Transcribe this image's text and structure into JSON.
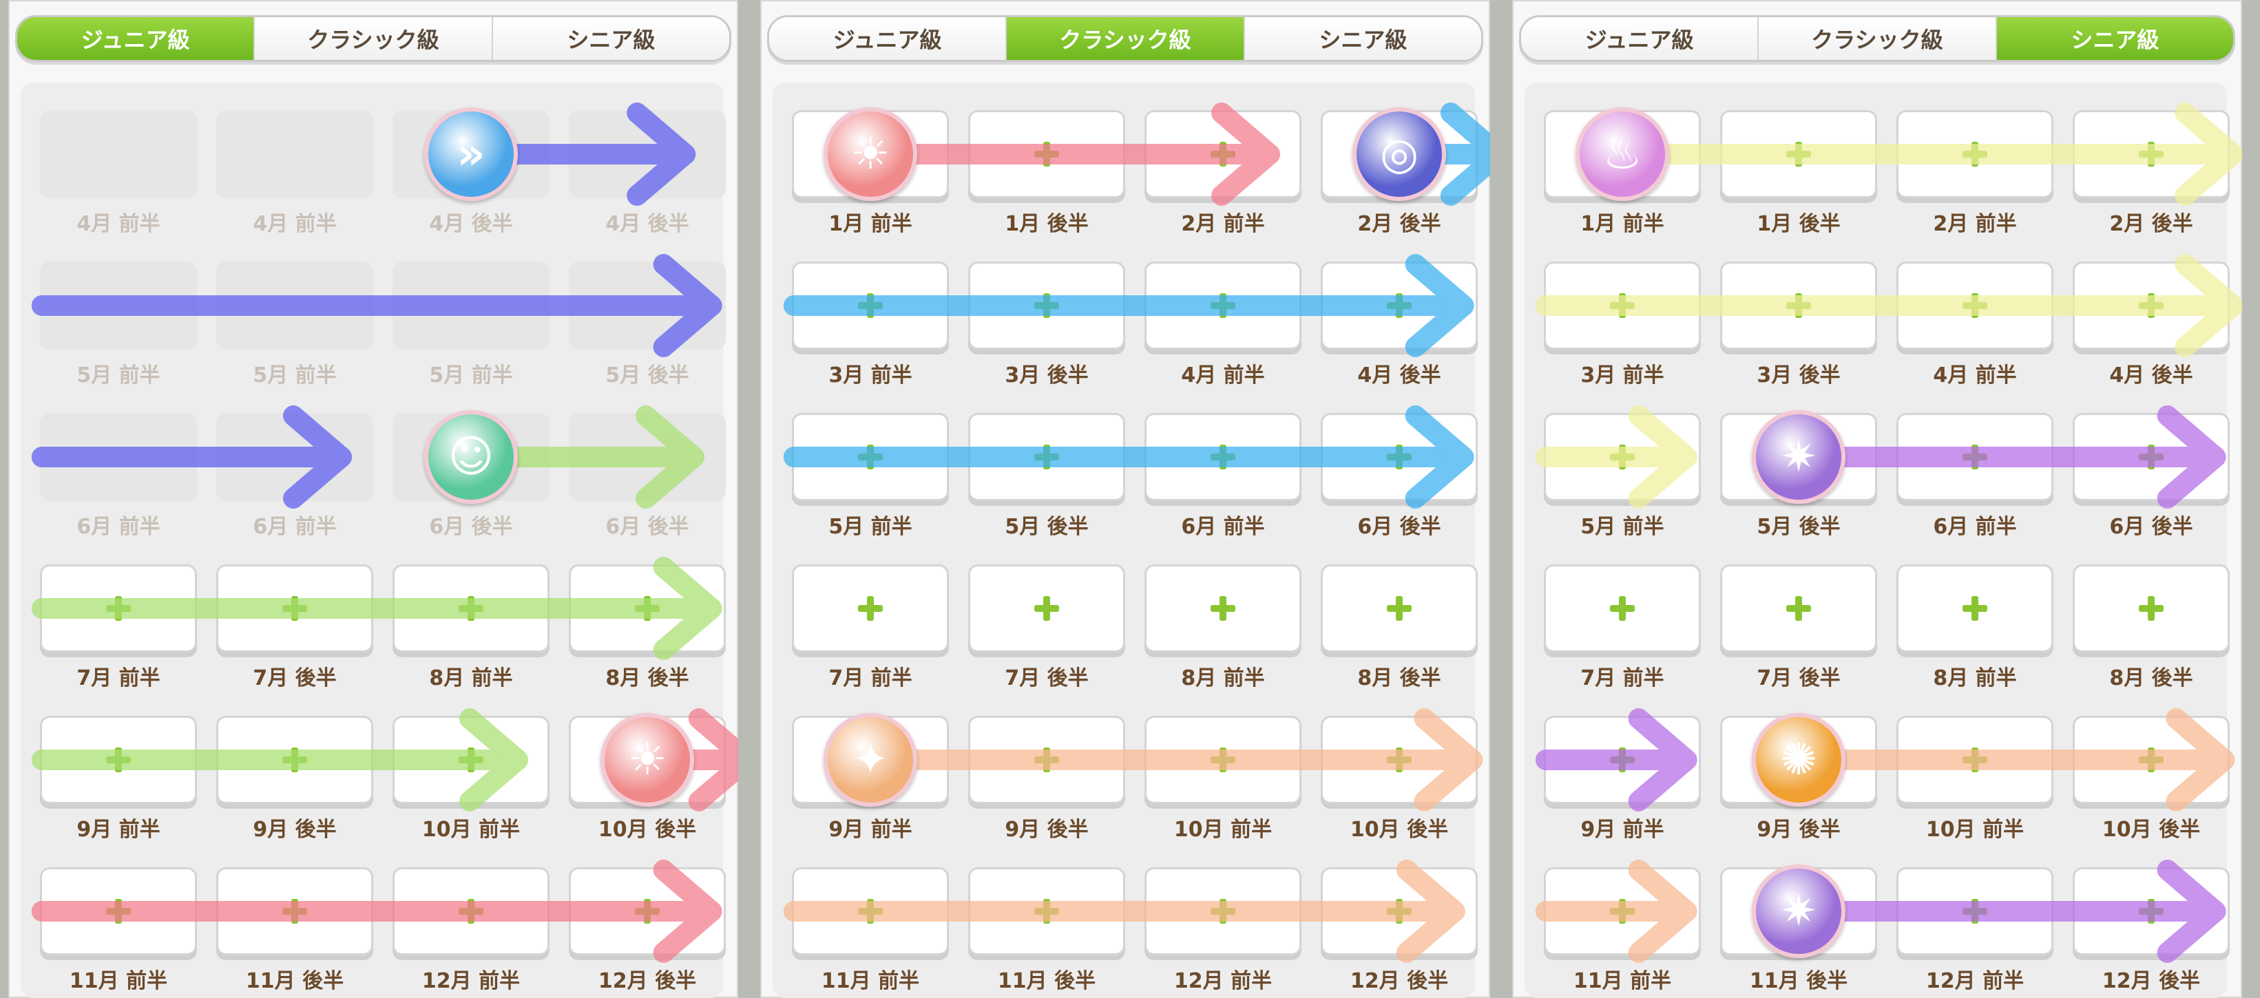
{
  "panels": [
    {
      "tabs": [
        {
          "label": "ジュニア級",
          "active": true
        },
        {
          "label": "クラシック級",
          "active": false
        },
        {
          "label": "シニア級",
          "active": false
        }
      ],
      "rows": [
        {
          "slots": [
            "empty",
            "empty",
            "empty",
            "empty"
          ],
          "labels": [
            "4月 前半",
            "4月 前半",
            "4月 後半",
            "4月 後半"
          ],
          "dim": true
        },
        {
          "slots": [
            "empty",
            "empty",
            "empty",
            "empty"
          ],
          "labels": [
            "5月 前半",
            "5月 前半",
            "5月 前半",
            "5月 後半"
          ],
          "dim": true
        },
        {
          "slots": [
            "empty",
            "empty",
            "empty",
            "empty"
          ],
          "labels": [
            "6月 前半",
            "6月 前半",
            "6月 後半",
            "6月 後半"
          ],
          "dim": true
        },
        {
          "slots": [
            "box",
            "box",
            "box",
            "box"
          ],
          "labels": [
            "7月 前半",
            "7月 後半",
            "8月 前半",
            "8月 後半"
          ],
          "dim": false
        },
        {
          "slots": [
            "box",
            "box",
            "box",
            "box"
          ],
          "labels": [
            "9月 前半",
            "9月 後半",
            "10月 前半",
            "10月 後半"
          ],
          "dim": false
        },
        {
          "slots": [
            "box",
            "box",
            "box",
            "box"
          ],
          "labels": [
            "11月 前半",
            "11月 後半",
            "12月 前半",
            "12月 後半"
          ],
          "dim": false
        }
      ],
      "icons": [
        {
          "name": "runner-skill-icon",
          "row": 0,
          "col": 2,
          "color": "#4aa6e8",
          "glyph": "»"
        },
        {
          "name": "smile-skill-icon",
          "row": 2,
          "col": 2,
          "color": "#58c89a",
          "glyph": "☺"
        },
        {
          "name": "meditate-skill-icon",
          "row": 4,
          "col": 3,
          "color": "#f08a8a",
          "glyph": "☀"
        }
      ],
      "arrows": [
        {
          "color": "#5b5cf0",
          "row": 0,
          "from": 2.6,
          "to": 3.7
        },
        {
          "color": "#5b5cf0",
          "row": 1,
          "from": 0.05,
          "to": 3.85
        },
        {
          "color": "#5b5cf0",
          "row": 2,
          "from": 0.05,
          "to": 1.75
        },
        {
          "color": "#a8e070",
          "row": 2,
          "from": 2.6,
          "to": 3.75
        },
        {
          "color": "#a8e070",
          "row": 3,
          "from": 0.05,
          "to": 3.85
        },
        {
          "color": "#a8e070",
          "row": 4,
          "from": 0.05,
          "to": 2.75
        },
        {
          "color": "#f37a8a",
          "row": 4,
          "from": 3.6,
          "to": 4.05
        },
        {
          "color": "#f37a8a",
          "row": 5,
          "from": 0.05,
          "to": 3.85
        }
      ]
    },
    {
      "tabs": [
        {
          "label": "ジュニア級",
          "active": false
        },
        {
          "label": "クラシック級",
          "active": true
        },
        {
          "label": "シニア級",
          "active": false
        }
      ],
      "rows": [
        {
          "slots": [
            "box",
            "box",
            "box",
            "box"
          ],
          "labels": [
            "1月 前半",
            "1月 後半",
            "2月 前半",
            "2月 後半"
          ],
          "dim": false
        },
        {
          "slots": [
            "box",
            "box",
            "box",
            "box"
          ],
          "labels": [
            "3月 前半",
            "3月 後半",
            "4月 前半",
            "4月 後半"
          ],
          "dim": false
        },
        {
          "slots": [
            "box",
            "box",
            "box",
            "box"
          ],
          "labels": [
            "5月 前半",
            "5月 後半",
            "6月 前半",
            "6月 後半"
          ],
          "dim": false
        },
        {
          "slots": [
            "box",
            "box",
            "box",
            "box"
          ],
          "labels": [
            "7月 前半",
            "7月 後半",
            "8月 前半",
            "8月 後半"
          ],
          "dim": false
        },
        {
          "slots": [
            "box",
            "box",
            "box",
            "box"
          ],
          "labels": [
            "9月 前半",
            "9月 後半",
            "10月 前半",
            "10月 後半"
          ],
          "dim": false
        },
        {
          "slots": [
            "box",
            "box",
            "box",
            "box"
          ],
          "labels": [
            "11月 前半",
            "11月 後半",
            "12月 前半",
            "12月 後半"
          ],
          "dim": false
        }
      ],
      "icons": [
        {
          "name": "meditate-skill-icon",
          "row": 0,
          "col": 0,
          "color": "#f08a8a",
          "glyph": "☀"
        },
        {
          "name": "wind-skill-icon",
          "row": 0,
          "col": 3,
          "color": "#5a5fd0",
          "glyph": "◎"
        },
        {
          "name": "boot-skill-icon",
          "row": 4,
          "col": 0,
          "color": "#f2b07a",
          "glyph": "✦"
        }
      ],
      "arrows": [
        {
          "color": "#f37a8a",
          "row": 0,
          "from": 0.6,
          "to": 2.75
        },
        {
          "color": "#38b0f0",
          "row": 0,
          "from": 3.6,
          "to": 4.05
        },
        {
          "color": "#38b0f0",
          "row": 1,
          "from": 0.05,
          "to": 3.85
        },
        {
          "color": "#38b0f0",
          "row": 2,
          "from": 0.05,
          "to": 3.85
        },
        {
          "color": "#f9b88f",
          "row": 4,
          "from": 0.6,
          "to": 3.9
        },
        {
          "color": "#f9b88f",
          "row": 5,
          "from": 0.05,
          "to": 3.8
        }
      ]
    },
    {
      "tabs": [
        {
          "label": "ジュニア級",
          "active": false
        },
        {
          "label": "クラシック級",
          "active": false
        },
        {
          "label": "シニア級",
          "active": true
        }
      ],
      "rows": [
        {
          "slots": [
            "box",
            "box",
            "box",
            "box"
          ],
          "labels": [
            "1月 前半",
            "1月 後半",
            "2月 前半",
            "2月 後半"
          ],
          "dim": false
        },
        {
          "slots": [
            "box",
            "box",
            "box",
            "box"
          ],
          "labels": [
            "3月 前半",
            "3月 後半",
            "4月 前半",
            "4月 後半"
          ],
          "dim": false
        },
        {
          "slots": [
            "box",
            "box",
            "box",
            "box"
          ],
          "labels": [
            "5月 前半",
            "5月 後半",
            "6月 前半",
            "6月 後半"
          ],
          "dim": false
        },
        {
          "slots": [
            "box",
            "box",
            "box",
            "box"
          ],
          "labels": [
            "7月 前半",
            "7月 後半",
            "8月 前半",
            "8月 後半"
          ],
          "dim": false
        },
        {
          "slots": [
            "box",
            "box",
            "box",
            "box"
          ],
          "labels": [
            "9月 前半",
            "9月 後半",
            "10月 前半",
            "10月 後半"
          ],
          "dim": false
        },
        {
          "slots": [
            "box",
            "box",
            "box",
            "box"
          ],
          "labels": [
            "11月 前半",
            "11月 後半",
            "12月 前半",
            "12月 後半"
          ],
          "dim": false
        }
      ],
      "icons": [
        {
          "name": "bath-skill-icon",
          "row": 0,
          "col": 0,
          "color": "#d98ae0",
          "glyph": "♨"
        },
        {
          "name": "star-skill-icon",
          "row": 2,
          "col": 1,
          "color": "#9a6fd8",
          "glyph": "✷"
        },
        {
          "name": "rainbow-skill-icon",
          "row": 4,
          "col": 1,
          "color": "#f0a030",
          "glyph": "✺"
        },
        {
          "name": "star-skill-icon",
          "row": 5,
          "col": 1,
          "color": "#9a6fd8",
          "glyph": "✷"
        }
      ],
      "arrows": [
        {
          "color": "#f0f09a",
          "row": 0,
          "from": 0.6,
          "to": 3.95
        },
        {
          "color": "#f0f09a",
          "row": 1,
          "from": 0.05,
          "to": 3.95
        },
        {
          "color": "#f0f09a",
          "row": 2,
          "from": 0.05,
          "to": 0.85
        },
        {
          "color": "#b36be8",
          "row": 2,
          "from": 1.6,
          "to": 3.85
        },
        {
          "color": "#b36be8",
          "row": 4,
          "from": 0.05,
          "to": 0.85
        },
        {
          "color": "#f9b88f",
          "row": 4,
          "from": 1.6,
          "to": 3.9
        },
        {
          "color": "#f9b88f",
          "row": 5,
          "from": 0.05,
          "to": 0.85
        },
        {
          "color": "#b36be8",
          "row": 5,
          "from": 1.6,
          "to": 3.85
        }
      ]
    }
  ]
}
